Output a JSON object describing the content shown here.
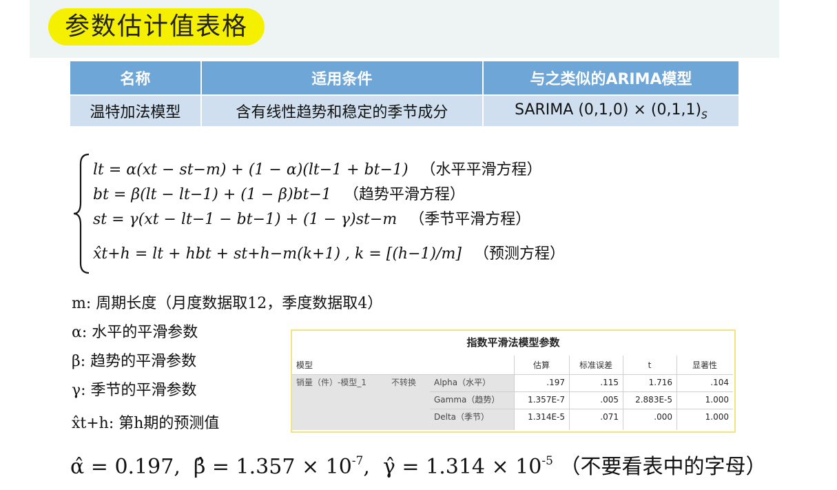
{
  "title": "参数估计值表格",
  "cond_table": {
    "headers": [
      "名称",
      "适用条件",
      "与之类似的ARIMA模型"
    ],
    "row": {
      "name": "温特加法模型",
      "condition": "含有线性趋势和稳定的季节成分",
      "arima": "SARIMA (0,1,0) × (0,1,1)",
      "arima_sub": "S"
    }
  },
  "equations": {
    "eq1": "lt = α(xt − st−m) + (1 − α)(lt−1 + bt−1)",
    "eq1_note": "（水平平滑方程）",
    "eq2": "bt = β(lt − lt−1) + (1 − β)bt−1",
    "eq2_note": "（趋势平滑方程）",
    "eq3": "st = γ(xt − lt−1 − bt−1) + (1 − γ)st−m",
    "eq3_note": "（季节平滑方程）",
    "eq4": "x̂t+h = lt + hbt + st+h−m(k+1) , k = [(h−1)/m]",
    "eq4_note": "（预测方程）"
  },
  "definitions": {
    "m": "m: 周期长度（月度数据取12，季度数据取4）",
    "alpha": "α: 水平的平滑参数",
    "beta": "β: 趋势的平滑参数",
    "gamma": "γ: 季节的平滑参数",
    "xhat": "x̂t+h: 第h期的预测值"
  },
  "spss_table": {
    "title": "指数平滑法模型参数",
    "col_model": "模型",
    "col_estimate": "估算",
    "col_se": "标准误差",
    "col_t": "t",
    "col_sig": "显著性",
    "model_name": "销量（件）-模型_1",
    "transform": "不转换",
    "rows": [
      {
        "param": "Alpha（水平）",
        "estimate": ".197",
        "se": ".115",
        "t": "1.716",
        "sig": ".104"
      },
      {
        "param": "Gamma（趋势）",
        "estimate": "1.357E-7",
        "se": ".005",
        "t": "2.883E-5",
        "sig": "1.000"
      },
      {
        "param": "Delta（季节）",
        "estimate": "1.314E-5",
        "se": ".071",
        "t": ".000",
        "sig": "1.000"
      }
    ]
  },
  "result": {
    "alpha": "α̂ = 0.197",
    "beta": "β̂ = 1.357 × 10",
    "beta_exp": "-7",
    "gamma": "γ̂ = 1.314 × 10",
    "gamma_exp": "-5",
    "note": "（不要看表中的字母）"
  }
}
